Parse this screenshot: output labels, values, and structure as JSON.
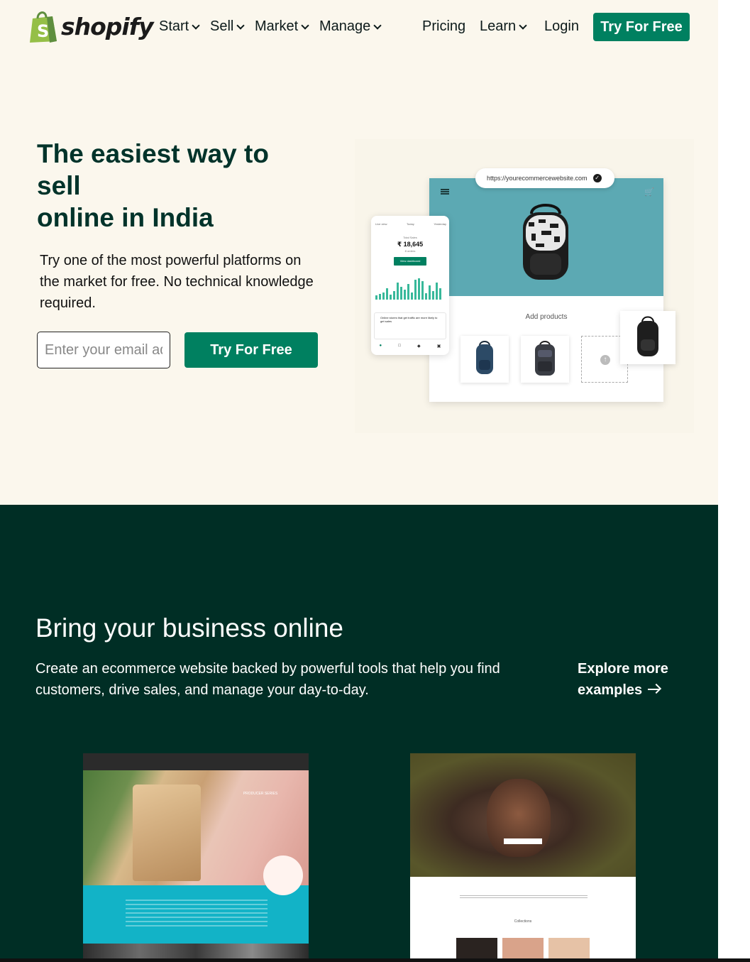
{
  "header": {
    "logo_text": "shopify",
    "nav": [
      {
        "label": "Start",
        "has_dropdown": true
      },
      {
        "label": "Sell",
        "has_dropdown": true
      },
      {
        "label": "Market",
        "has_dropdown": true
      },
      {
        "label": "Manage",
        "has_dropdown": true
      }
    ],
    "right_nav": [
      {
        "label": "Pricing",
        "has_dropdown": false
      },
      {
        "label": "Learn",
        "has_dropdown": true
      },
      {
        "label": "Login",
        "has_dropdown": false
      }
    ],
    "cta_label": "Try For Free"
  },
  "hero": {
    "title_lines": [
      "The easiest way to",
      "sell",
      "online in India"
    ],
    "subtitle": "Try one of the most powerful platforms on the market for free. No technical knowledge required.",
    "email_placeholder": "Enter your email address",
    "cta_label": "Try For Free",
    "illustration": {
      "url": "https://yourecommercewebsite.com",
      "add_products_label": "Add products",
      "phone": {
        "tabs": [
          "Live view",
          "Today",
          "Yesterday"
        ],
        "total_sales_label": "Total Sales",
        "total_sales_value": "₹ 18,645",
        "orders_label": "8 orders",
        "dashboard_button": "View dashboard",
        "note_title": "Online stores that get traffic are more likely to get sales"
      }
    }
  },
  "business": {
    "title": "Bring your business online",
    "subtitle": "Create an ecommerce website backed by powerful tools that help you find customers, drive sales, and manage your day-to-day.",
    "explore_label": "Explore more examples",
    "examples": [
      {
        "caption": "PRODUCER SERIES"
      },
      {
        "caption": "Collections"
      }
    ]
  },
  "colors": {
    "brand_green": "#008060",
    "hero_bg": "#fbf7ed",
    "dark_bg": "#002e25",
    "title_green": "#00332a"
  }
}
